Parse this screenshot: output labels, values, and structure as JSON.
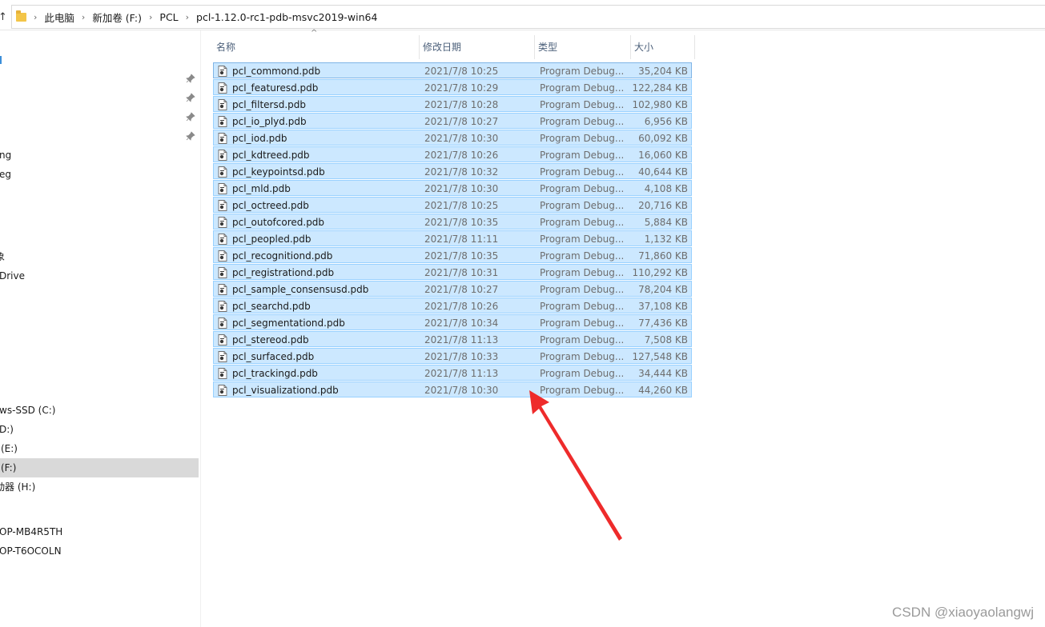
{
  "address": {
    "crumbs": [
      "此电脑",
      "新加卷 (F:)",
      "PCL",
      "pcl-1.12.0-rc1-pdb-msvc2019-win64"
    ]
  },
  "nav": {
    "items": [
      {
        "label": "ng",
        "pinned": false
      },
      {
        "label": "eg",
        "pinned": false
      },
      {
        "label": "象",
        "pinned": false
      },
      {
        "label": "Drive",
        "pinned": false
      },
      {
        "label": "ws-SSD (C:)",
        "pinned": false
      },
      {
        "label": "D:)",
        "pinned": false
      },
      {
        "label": "(E:)",
        "pinned": false
      },
      {
        "label": "(F:)",
        "pinned": false,
        "selected": true
      },
      {
        "label": "动器 (H:)",
        "pinned": false
      },
      {
        "label": "OP-MB4R5TH",
        "pinned": false
      },
      {
        "label": "OP-T6OCOLN",
        "pinned": false
      }
    ]
  },
  "columns": {
    "name": "名称",
    "date": "修改日期",
    "type": "类型",
    "size": "大小"
  },
  "files": [
    {
      "name": "pcl_commond.pdb",
      "date": "2021/7/8 10:25",
      "type": "Program Debug...",
      "size": "35,204 KB"
    },
    {
      "name": "pcl_featuresd.pdb",
      "date": "2021/7/8 10:29",
      "type": "Program Debug...",
      "size": "122,284 KB"
    },
    {
      "name": "pcl_filtersd.pdb",
      "date": "2021/7/8 10:28",
      "type": "Program Debug...",
      "size": "102,980 KB"
    },
    {
      "name": "pcl_io_plyd.pdb",
      "date": "2021/7/8 10:27",
      "type": "Program Debug...",
      "size": "6,956 KB"
    },
    {
      "name": "pcl_iod.pdb",
      "date": "2021/7/8 10:30",
      "type": "Program Debug...",
      "size": "60,092 KB"
    },
    {
      "name": "pcl_kdtreed.pdb",
      "date": "2021/7/8 10:26",
      "type": "Program Debug...",
      "size": "16,060 KB"
    },
    {
      "name": "pcl_keypointsd.pdb",
      "date": "2021/7/8 10:32",
      "type": "Program Debug...",
      "size": "40,644 KB"
    },
    {
      "name": "pcl_mld.pdb",
      "date": "2021/7/8 10:30",
      "type": "Program Debug...",
      "size": "4,108 KB"
    },
    {
      "name": "pcl_octreed.pdb",
      "date": "2021/7/8 10:25",
      "type": "Program Debug...",
      "size": "20,716 KB"
    },
    {
      "name": "pcl_outofcored.pdb",
      "date": "2021/7/8 10:35",
      "type": "Program Debug...",
      "size": "5,884 KB"
    },
    {
      "name": "pcl_peopled.pdb",
      "date": "2021/7/8 11:11",
      "type": "Program Debug...",
      "size": "1,132 KB"
    },
    {
      "name": "pcl_recognitiond.pdb",
      "date": "2021/7/8 10:35",
      "type": "Program Debug...",
      "size": "71,860 KB"
    },
    {
      "name": "pcl_registrationd.pdb",
      "date": "2021/7/8 10:31",
      "type": "Program Debug...",
      "size": "110,292 KB"
    },
    {
      "name": "pcl_sample_consensusd.pdb",
      "date": "2021/7/8 10:27",
      "type": "Program Debug...",
      "size": "78,204 KB"
    },
    {
      "name": "pcl_searchd.pdb",
      "date": "2021/7/8 10:26",
      "type": "Program Debug...",
      "size": "37,108 KB"
    },
    {
      "name": "pcl_segmentationd.pdb",
      "date": "2021/7/8 10:34",
      "type": "Program Debug...",
      "size": "77,436 KB"
    },
    {
      "name": "pcl_stereod.pdb",
      "date": "2021/7/8 11:13",
      "type": "Program Debug...",
      "size": "7,508 KB"
    },
    {
      "name": "pcl_surfaced.pdb",
      "date": "2021/7/8 10:33",
      "type": "Program Debug...",
      "size": "127,548 KB"
    },
    {
      "name": "pcl_trackingd.pdb",
      "date": "2021/7/8 11:13",
      "type": "Program Debug...",
      "size": "34,444 KB"
    },
    {
      "name": "pcl_visualizationd.pdb",
      "date": "2021/7/8 10:30",
      "type": "Program Debug...",
      "size": "44,260 KB"
    }
  ],
  "colors": {
    "selection_bg": "#cce8ff",
    "selection_border": "#99d1ff",
    "arrow": "#ee2b2b",
    "nav_selected": "#d9d9d9"
  },
  "watermark": "CSDN @xiaoyaolangwj"
}
